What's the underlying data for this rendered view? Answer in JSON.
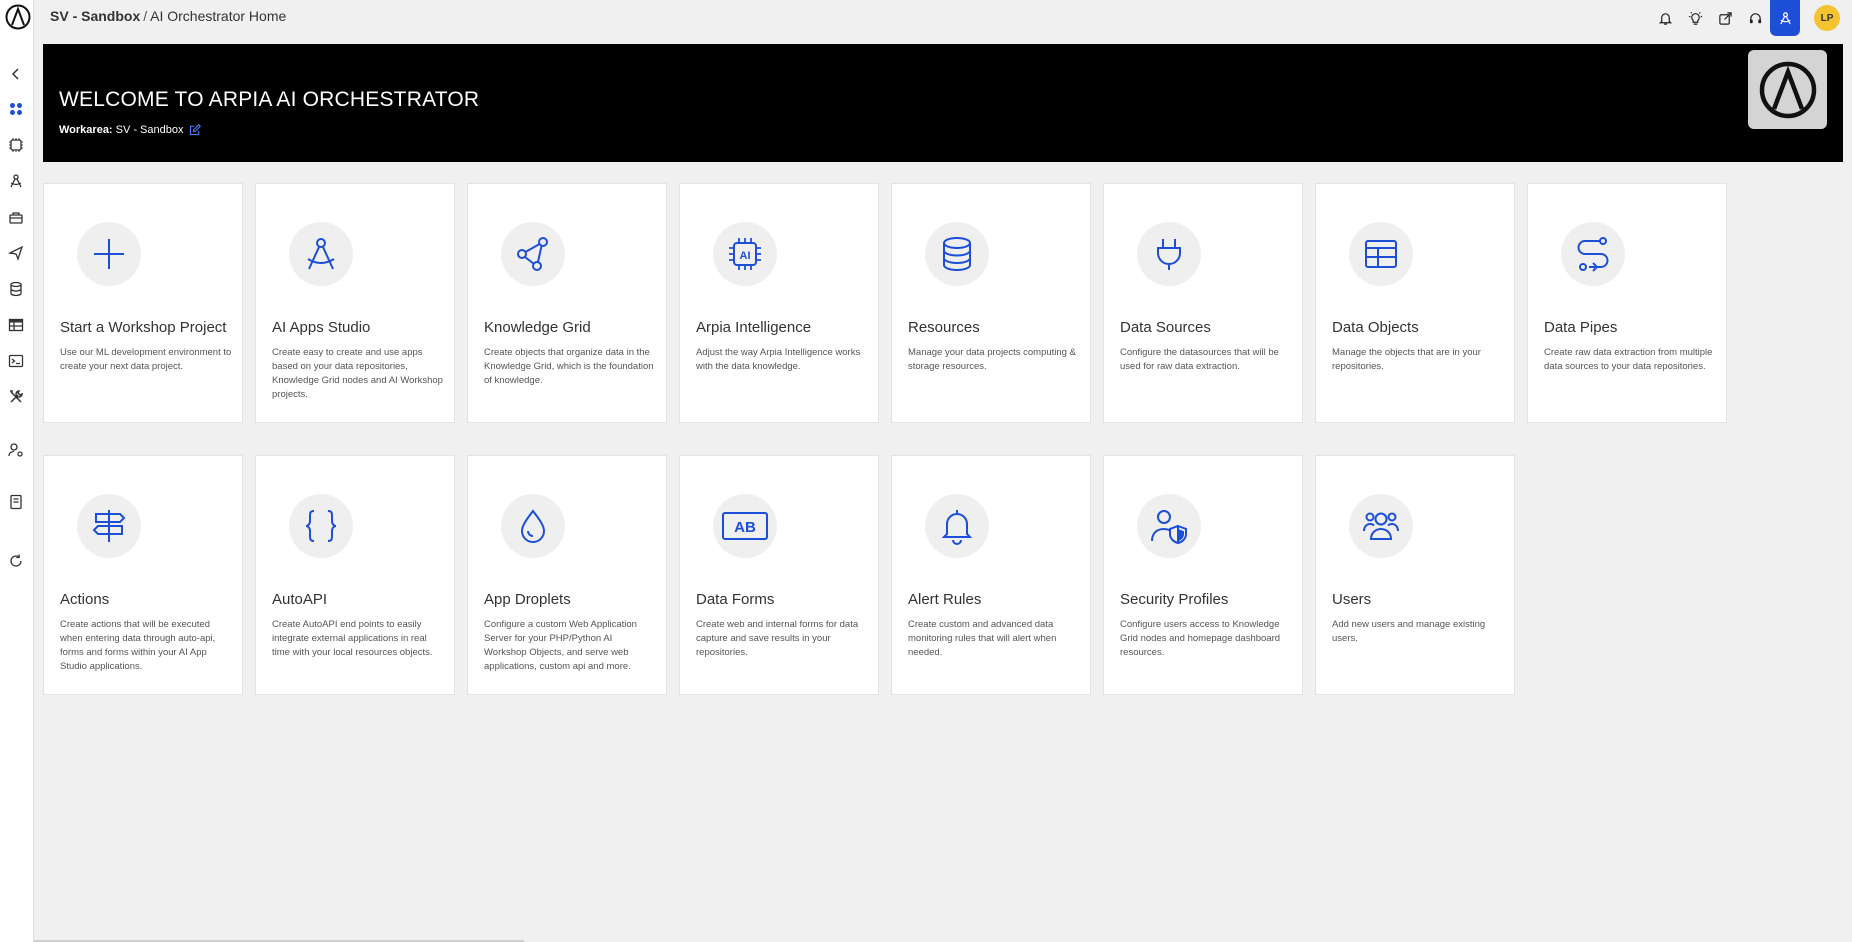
{
  "topbar": {
    "workspace": "SV - Sandbox",
    "separator": "/",
    "page": "AI Orchestrator Home",
    "avatar_initials": "LP"
  },
  "banner": {
    "title": "WELCOME TO ARPIA AI ORCHESTRATOR",
    "workarea_label": "Workarea:",
    "workarea_value": "SV - Sandbox"
  },
  "colors": {
    "accent": "#1d4ed8",
    "banner_bg": "#000000",
    "page_bg": "#f0f0f0",
    "avatar": "#f4c430"
  },
  "cards": [
    {
      "title": "Start a Workshop Project",
      "desc": "Use our ML development environment to create your next data project.",
      "icon": "plus-icon"
    },
    {
      "title": "AI Apps Studio",
      "desc": "Create easy to create and use apps based on your data repositories, Knowledge Grid nodes and AI Workshop projects.",
      "icon": "compass-icon"
    },
    {
      "title": "Knowledge Grid",
      "desc": "Create objects that organize data in the Knowledge Grid, which is the foundation of knowledge.",
      "icon": "graph-nodes-icon"
    },
    {
      "title": "Arpia Intelligence",
      "desc": "Adjust the way Arpia Intelligence works with the data knowledge.",
      "icon": "ai-chip-icon"
    },
    {
      "title": "Resources",
      "desc": "Manage your data projects computing & storage resources.",
      "icon": "database-icon"
    },
    {
      "title": "Data Sources",
      "desc": "Configure the datasources that will be used for raw data extraction.",
      "icon": "plug-icon"
    },
    {
      "title": "Data Objects",
      "desc": "Manage the objects that are in your repositories.",
      "icon": "table-icon"
    },
    {
      "title": "Data Pipes",
      "desc": "Create raw data extraction from multiple data sources to your data repositories.",
      "icon": "pipes-icon"
    },
    {
      "title": "Actions",
      "desc": "Create actions that will be executed when entering data through auto-api, forms and forms within your AI App Studio applications.",
      "icon": "signpost-icon"
    },
    {
      "title": "AutoAPI",
      "desc": "Create AutoAPI end points to easily integrate external applications in real time with your local resources objects.",
      "icon": "braces-icon"
    },
    {
      "title": "App Droplets",
      "desc": "Configure a custom Web Application Server for your PHP/Python AI Workshop Objects, and serve web applications, custom api and more.",
      "icon": "droplet-icon"
    },
    {
      "title": "Data Forms",
      "desc": "Create web and internal forms for data capture and save results in your repositories.",
      "icon": "form-ab-icon"
    },
    {
      "title": "Alert Rules",
      "desc": "Create custom and advanced data monitoring rules that will alert when needed.",
      "icon": "bell-icon"
    },
    {
      "title": "Security Profiles",
      "desc": "Configure users access to Knowledge Grid nodes and homepage dashboard resources.",
      "icon": "user-shield-icon"
    },
    {
      "title": "Users",
      "desc": "Add new users and manage existing users.",
      "icon": "users-icon"
    }
  ]
}
